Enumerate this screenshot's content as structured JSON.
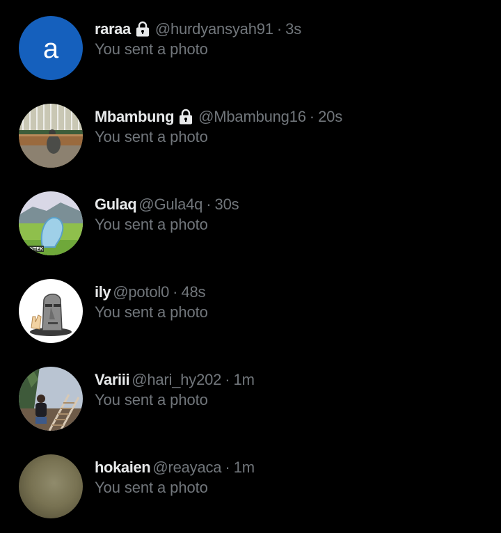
{
  "conversations": [
    {
      "name": "raraa",
      "locked": true,
      "handle": "@hurdyansyah91",
      "time": "3s",
      "preview": "You sent a photo",
      "avatar": {
        "type": "letter",
        "letter": "a",
        "color": "#1560bd"
      }
    },
    {
      "name": "Mbambung",
      "locked": true,
      "handle": "@Mbambung16",
      "time": "20s",
      "preview": "You sent a photo",
      "avatar": {
        "type": "photo",
        "subject": "bird-cage"
      }
    },
    {
      "name": "Gulaq",
      "locked": false,
      "handle": "@Gula4q",
      "time": "30s",
      "preview": "You sent a photo",
      "avatar": {
        "type": "photo",
        "subject": "landscape",
        "caption": "PANTEK"
      }
    },
    {
      "name": "ily",
      "locked": false,
      "handle": "@potol0",
      "time": "48s",
      "preview": "You sent a photo",
      "avatar": {
        "type": "photo",
        "subject": "moai-emoji"
      }
    },
    {
      "name": "Variii",
      "locked": false,
      "handle": "@hari_hy202",
      "time": "1m",
      "preview": "You sent a photo",
      "avatar": {
        "type": "photo",
        "subject": "person-on-stairs"
      }
    },
    {
      "name": "hokaien",
      "locked": false,
      "handle": "@reayaca",
      "time": "1m",
      "preview": "You sent a photo",
      "avatar": {
        "type": "photo",
        "subject": "blurry"
      }
    }
  ],
  "separator": "·",
  "icons": {
    "lock": "lock-icon"
  },
  "colors": {
    "background": "#000000",
    "name_text": "#e7e9ea",
    "secondary_text": "#71767b"
  }
}
